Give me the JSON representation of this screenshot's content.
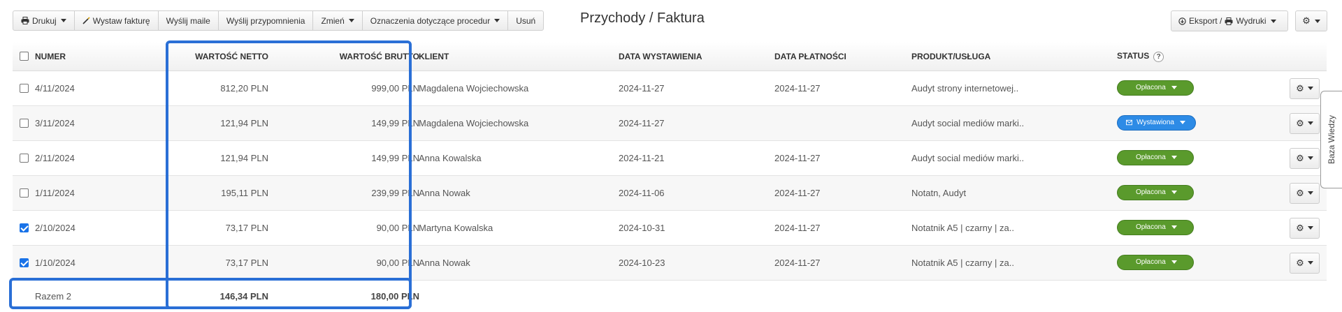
{
  "toolbar": {
    "print": "Drukuj",
    "issue_invoice": "Wystaw fakturę",
    "send_emails": "Wyślij maile",
    "send_reminders": "Wyślij przypomnienia",
    "change": "Zmień",
    "procedure_marks": "Oznaczenia dotyczące procedur",
    "delete": "Usuń"
  },
  "page_title": "Przychody / Faktura",
  "export_label": "Eksport / ",
  "prints_label": "Wydruki",
  "columns": {
    "numer": "NUMER",
    "netto": "WARTOŚĆ NETTO",
    "brutto": "WARTOŚĆ BRUTTO",
    "klient": "KLIENT",
    "data_wystawienia": "DATA WYSTAWIENIA",
    "data_platnosci": "DATA PŁATNOŚCI",
    "produkt": "PRODUKT/USŁUGA",
    "status": "STATUS"
  },
  "help_mark": "?",
  "rows": [
    {
      "checked": false,
      "numer": "4/11/2024",
      "netto": "812,20 PLN",
      "brutto": "999,00 PLN",
      "klient": "Magdalena Wojciechowska",
      "data_wystawienia": "2024-11-27",
      "data_platnosci": "2024-11-27",
      "produkt": "Audyt strony internetowej..",
      "status": "Opłacona",
      "status_color": "#5a9a2c"
    },
    {
      "checked": false,
      "numer": "3/11/2024",
      "netto": "121,94 PLN",
      "brutto": "149,99 PLN",
      "klient": "Magdalena Wojciechowska",
      "data_wystawienia": "2024-11-27",
      "data_platnosci": "",
      "produkt": "Audyt social mediów marki..",
      "status": "Wystawiona",
      "status_color": "#2d8be6"
    },
    {
      "checked": false,
      "numer": "2/11/2024",
      "netto": "121,94 PLN",
      "brutto": "149,99 PLN",
      "klient": "Anna Kowalska",
      "data_wystawienia": "2024-11-21",
      "data_platnosci": "2024-11-27",
      "produkt": "Audyt social mediów marki..",
      "status": "Opłacona",
      "status_color": "#5a9a2c"
    },
    {
      "checked": false,
      "numer": "1/11/2024",
      "netto": "195,11 PLN",
      "brutto": "239,99 PLN",
      "klient": "Anna Nowak",
      "data_wystawienia": "2024-11-06",
      "data_platnosci": "2024-11-27",
      "produkt": "Notatn, Audyt",
      "status": "Opłacona",
      "status_color": "#5a9a2c"
    },
    {
      "checked": true,
      "numer": "2/10/2024",
      "netto": "73,17 PLN",
      "brutto": "90,00 PLN",
      "klient": "Martyna Kowalska",
      "data_wystawienia": "2024-10-31",
      "data_platnosci": "2024-11-27",
      "produkt": "Notatnik A5 | czarny | za..",
      "status": "Opłacona",
      "status_color": "#5a9a2c"
    },
    {
      "checked": true,
      "numer": "1/10/2024",
      "netto": "73,17 PLN",
      "brutto": "90,00 PLN",
      "klient": "Anna Nowak",
      "data_wystawienia": "2024-10-23",
      "data_platnosci": "2024-11-27",
      "produkt": "Notatnik A5 | czarny | za..",
      "status": "Opłacona",
      "status_color": "#5a9a2c"
    }
  ],
  "footer": {
    "label": "Razem 2",
    "netto": "146,34 PLN",
    "brutto": "180,00 PLN"
  },
  "side_tab": "Baza Wiedzy",
  "highlight_color": "#2a6fd6"
}
